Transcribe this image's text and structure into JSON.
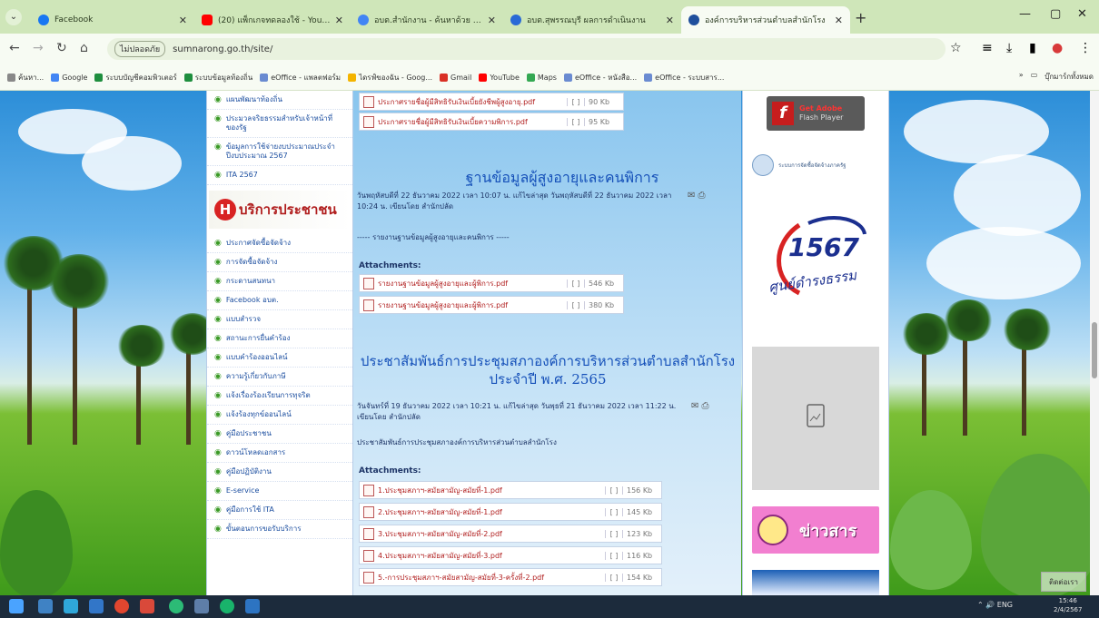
{
  "browser": {
    "tabs": [
      {
        "title": "Facebook",
        "color": "#1877f2",
        "active": false
      },
      {
        "title": "(20) แพ็กเกจทดลองใช้ - YouTube",
        "color": "#ff0000",
        "active": false
      },
      {
        "title": "อบต.สำนักงาน - ค้นหาด้วย Google",
        "color": "#4285f4",
        "active": false
      },
      {
        "title": "อบต.สุพรรณบุรี ผลการดำเนินงาน",
        "color": "#2a6ad6",
        "active": false
      },
      {
        "title": "องค์การบริหารส่วนตำบลสำนักโรง",
        "color": "#1f4f9c",
        "active": true
      }
    ],
    "site_info": "ไม่ปลอดภัย",
    "url": "sumnarong.go.th/site/",
    "bookmarks": [
      {
        "label": "ค้นหา...",
        "color": "#888888"
      },
      {
        "label": "Google",
        "color": "#4285f4"
      },
      {
        "label": "ระบบบัญชีคอมพิวเตอร์",
        "color": "#1e8e3e"
      },
      {
        "label": "ระบบข้อมูลท้องถิ่น",
        "color": "#1e8e3e"
      },
      {
        "label": "eOffice - แพลตฟอร์ม",
        "color": "#6a8bd1"
      },
      {
        "label": "ไดรฟ์ของฉัน - Goog...",
        "color": "#f4b400"
      },
      {
        "label": "Gmail",
        "color": "#d93025"
      },
      {
        "label": "YouTube",
        "color": "#ff0000"
      },
      {
        "label": "Maps",
        "color": "#34a853"
      },
      {
        "label": "eOffice - หนังสือ...",
        "color": "#6a8bd1"
      },
      {
        "label": "eOffice - ระบบสาร...",
        "color": "#6a8bd1"
      }
    ],
    "bookmarks_right": "บุ๊กมาร์กทั้งหมด"
  },
  "left_nav": {
    "top_items": [
      "แผนพัฒนาท้องถิ่น",
      "ประมวลจริยธรรมสำหรับเจ้าหน้าที่ของรัฐ",
      "ข้อมูลการใช้จ่ายงบประมาณประจำปีงบประมาณ 2567",
      "ITA 2567"
    ],
    "service_title": "บริการประชาชน",
    "service_items": [
      "ประกาศจัดซื้อจัดจ้าง",
      "การจัดซื้อจัดจ้าง",
      "กระดานสนทนา",
      "Facebook อบต.",
      "แบบสำรวจ",
      "สถานะการยื่นคำร้อง",
      "แบบคำร้องออนไลน์",
      "ความรู้เกี่ยวกับภาษี",
      "แจ้งเรื่องร้องเรียนการทุจริต",
      "แจ้งร้องทุกข์ออนไลน์",
      "คู่มือประชาชน",
      "ดาวน์โหลดเอกสาร",
      "คู่มือปฏิบัติงาน",
      "E-service",
      "คู่มือการใช้ ITA",
      "ขั้นตอนการขอรับบริการ"
    ]
  },
  "main": {
    "top_attachments": [
      {
        "name": "ประกาศรายชื่อผู้มีสิทธิรับเงินเบี้ยยังชีพผู้สูงอายุ.pdf",
        "brackets": "[ ]",
        "size": "90 Kb"
      },
      {
        "name": "ประกาศรายชื่อผู้มีสิทธิรับเงินเบี้ยความพิการ.pdf",
        "brackets": "[ ]",
        "size": "95 Kb"
      }
    ],
    "post1": {
      "title": "ฐานข้อมูลผู้สูงอายุและคนพิการ",
      "meta": "วันพฤหัสบดีที่ 22 ธันวาคม 2022 เวลา 10:07 น. แก้ไขล่าสุด วันพฤหัสบดีที่ 22 ธันวาคม 2022 เวลา 10:24 น. เขียนโดย สำนักปลัด",
      "body": "----- รายงานฐานข้อมูลผู้สูงอายุและคนพิการ -----",
      "attachments_label": "Attachments:",
      "attachments": [
        {
          "name": "รายงานฐานข้อมูลผู้สูงอายุและผู้พิการ.pdf",
          "brackets": "[ ]",
          "size": "546 Kb"
        },
        {
          "name": "รายงานฐานข้อมูลผู้สูงอายุและผู้พิการ.pdf",
          "brackets": "[ ]",
          "size": "380 Kb"
        }
      ]
    },
    "post2": {
      "title": "ประชาสัมพันธ์การประชุมสภาองค์การบริหารส่วนตำบลสำนักโรง ประจำปี พ.ศ. 2565",
      "meta": "วันจันทร์ที่ 19 ธันวาคม 2022 เวลา 10:21 น. แก้ไขล่าสุด วันพุธที่ 21 ธันวาคม 2022 เวลา 11:22 น. เขียนโดย สำนักปลัด",
      "body": "ประชาสัมพันธ์การประชุมสภาองค์การบริหารส่วนตำบลสำนักโรง",
      "attachments_label": "Attachments:",
      "attachments": [
        {
          "name": "1.ประชุมสภาฯ-สมัยสามัญ-สมัยที่-1.pdf",
          "brackets": "[ ]",
          "size": "156 Kb"
        },
        {
          "name": "2.ประชุมสภาฯ-สมัยสามัญ-สมัยที่-1.pdf",
          "brackets": "[ ]",
          "size": "145 Kb"
        },
        {
          "name": "3.ประชุมสภาฯ-สมัยสามัญ-สมัยที่-2.pdf",
          "brackets": "[ ]",
          "size": "123 Kb"
        },
        {
          "name": "4.ประชุมสภาฯ-สมัยสามัญ-สมัยที่-3.pdf",
          "brackets": "[ ]",
          "size": "116 Kb"
        },
        {
          "name": "5.-การประชุมสภาฯ-สมัยสามัญ-สมัยที่-3-ครั้งที่-2.pdf",
          "brackets": "[ ]",
          "size": "154 Kb"
        }
      ]
    }
  },
  "right_col": {
    "adobe_title": "Get Adobe",
    "adobe_sub": "Flash Player",
    "partner_text": "ระบบการจัดซื้อจัดจ้างภาครัฐ",
    "hotline_number": "1567",
    "hotline_tagline": "ศูนย์ดำรงธรรม",
    "news_title": "ข่าวสาร"
  },
  "overlay": {
    "chip_label": "ติดต่อเรา"
  },
  "taskbar": {
    "time": "15:46",
    "date": "2/4/2567",
    "tray_text": "ENG"
  }
}
